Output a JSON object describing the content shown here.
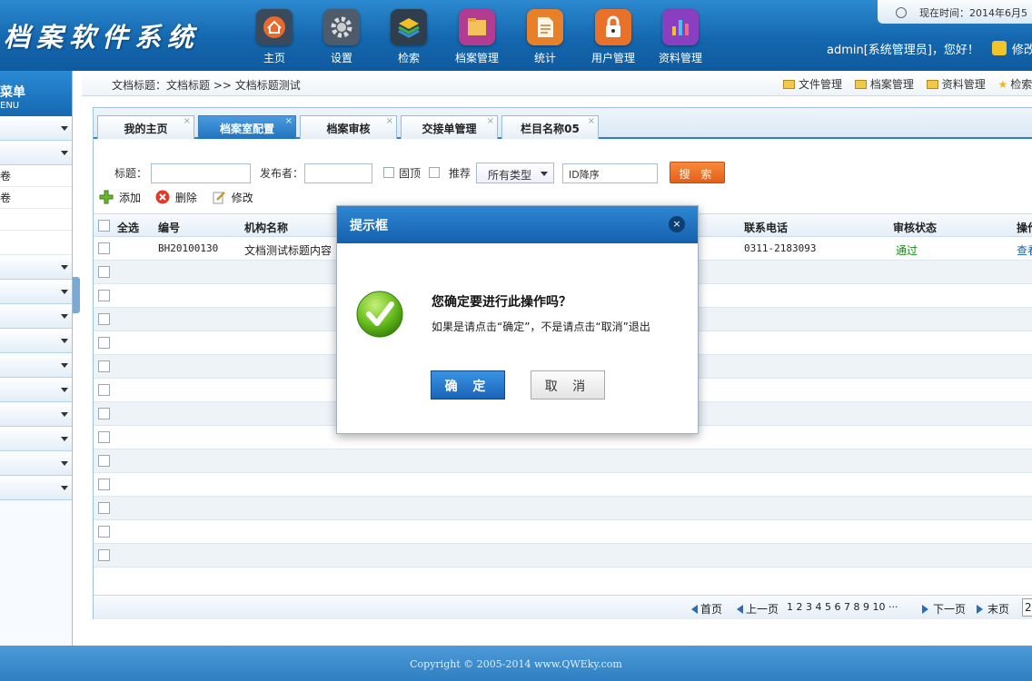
{
  "header": {
    "logo": "档案软件系统",
    "nav": [
      {
        "label": "主页",
        "icon": "home-icon",
        "color": "#e86a2c"
      },
      {
        "label": "设置",
        "icon": "gear-icon",
        "color": "#6b7a8c"
      },
      {
        "label": "检索",
        "icon": "layers-icon",
        "color": "#2c7a3a"
      },
      {
        "label": "档案管理",
        "icon": "folder-icon",
        "color": "#d04aa4"
      },
      {
        "label": "统计",
        "icon": "document-icon",
        "color": "#f08a2a"
      },
      {
        "label": "用户管理",
        "icon": "lock-icon",
        "color": "#e8722a"
      },
      {
        "label": "资料管理",
        "icon": "bar-chart-icon",
        "color": "#9a4ac8"
      }
    ],
    "time": "现在时间：2014年6月5",
    "user": "admin[系统管理员]，您好！",
    "user_action": "修改"
  },
  "sidebar": {
    "title": "菜单",
    "subtitle": "ENU",
    "sub_items": [
      "卷",
      "卷"
    ]
  },
  "breadcrumb": "文档标题：文档标题 >> 文档标题测试",
  "quicklinks": [
    "文件管理",
    "档案管理",
    "资料管理",
    "检索"
  ],
  "tabs": [
    "我的主页",
    "档案室配置",
    "档案审核",
    "交接单管理",
    "栏目名称05"
  ],
  "search": {
    "title_label": "标题：",
    "publisher_label": "发布者：",
    "pin_label": "固顶",
    "recommend_label": "推荐",
    "type_value": "所有类型",
    "sort_value": "ID降序",
    "button": "搜 索"
  },
  "toolbar": {
    "add": "添加",
    "delete": "删除",
    "edit": "修改"
  },
  "table": {
    "headers": {
      "select_all": "全选",
      "number": "编号",
      "org_name": "机构名称",
      "phone": "联系电话",
      "status": "审核状态",
      "action": "操作"
    },
    "rows": [
      {
        "number": "BH20100130",
        "org_name": "文档测试标题内容",
        "phone": "0311-2183093",
        "status": "通过",
        "action": "查看"
      }
    ]
  },
  "pager": {
    "first": "首页",
    "prev": "上一页",
    "pages": "1 2 3 4 5 6 7 8 9 10 ···",
    "next": "下一页",
    "last": "末页",
    "page_input": "2"
  },
  "footer": "Copyright © 2005-2014 www.QWEky.com",
  "dialog": {
    "title": "提示框",
    "close": "×",
    "message": "您确定要进行此操作吗？",
    "sub": "如果是请点击“确定”，不是请点击“取消”退出",
    "ok": "确 定",
    "cancel": "取 消"
  }
}
